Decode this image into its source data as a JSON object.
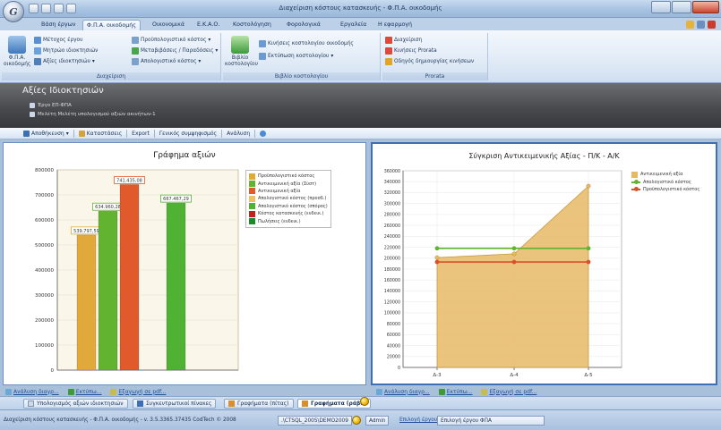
{
  "window": {
    "title": "Διαχείριση κόστους κατασκευής - Φ.Π.Α. οικοδομής",
    "orb_logo": "G"
  },
  "ribbon": {
    "tabs": [
      {
        "label": "Βάση έργων",
        "active": false
      },
      {
        "label": "Φ.Π.Α. οικοδομής",
        "active": true
      },
      {
        "label": "Οικονομικά",
        "active": false
      },
      {
        "label": "Ε.Κ.Α.Ο.",
        "active": false
      },
      {
        "label": "Κοστολόγηση",
        "active": false
      },
      {
        "label": "Φορολογικά",
        "active": false
      },
      {
        "label": "Εργαλεία",
        "active": false
      },
      {
        "label": "Η εφαρμογή",
        "active": false
      }
    ],
    "groups": {
      "management": {
        "label": "Διαχείριση",
        "big_button": "Φ.Π.Α. οικοδομής",
        "items": [
          "Μέτοχος έργου",
          "Μητρώο ιδιοκτησιών",
          "Αξίες ιδιοκτησιών",
          "Προϋπολογιστικό κόστος",
          "Μεταβιβάσεις / Παραδόσεις",
          "Απολογιστικό κόστος"
        ]
      },
      "costing": {
        "label": "Βιβλίο κοστολογίου",
        "big_button": "Βιβλίο κοστολογίου",
        "items": [
          "Κινήσεις κοστολογίου οικοδομής",
          "Εκτύπωση κοστολογίου"
        ]
      },
      "prorata": {
        "label": "Prorata",
        "items": [
          "Διαχείριση",
          "Κινήσεις Prorata",
          "Οδηγός δημιουργίας κινήσεων"
        ]
      }
    }
  },
  "banner": {
    "title": "Αξίες Ιδιοκτησιών",
    "line1": "Έργο ΕΠ-ΦΠΑ",
    "line2": "Μελέτη Μελέτη υπολογισμού αξιών ακινήτων-1"
  },
  "toolbar": {
    "items": [
      "Αποθήκευση",
      "Καταστάσεις",
      "Export",
      "Γενικός συμψηφισμός",
      "Ανάλυση"
    ]
  },
  "links": [
    "Ανάλυση διαγρ...",
    "Εκτύπω...",
    "Εξαγωγή σε pdf..."
  ],
  "bottom_tabs": [
    {
      "label": "Υπολογισμός αξιών ιδιοκτησιών",
      "active": false
    },
    {
      "label": "Συγκεντρωτικοί πίνακες",
      "active": false
    },
    {
      "label": "Γραφήματα (πίτας)",
      "active": false
    },
    {
      "label": "Γραφήματα (ράβδ)",
      "active": true
    }
  ],
  "statusbar": {
    "left": "Διαχείριση κόστους κατασκευής - Φ.Π.Α. οικοδομής - v. 3.5.3365.37435 CodTech © 2008",
    "server": ".\\CTSQL_2005\\DEMO2009",
    "user": "Admin",
    "link": "Επιλογή έργου",
    "project": "Επιλογή έργου ΦΠΑ"
  },
  "colors": {
    "ribbon_active": "#f4f8fd",
    "banner": "#46484b",
    "accent_blue": "#3c6fb4"
  },
  "chart_data": [
    {
      "type": "bar",
      "title": "Γράφημα αξιών",
      "ylim": [
        0,
        800000
      ],
      "yticks": [
        "0",
        "100000",
        "200000",
        "300000",
        "400000",
        "500000",
        "600000",
        "700000",
        "800000"
      ],
      "grid": true,
      "legend_position": "right",
      "series": [
        {
          "name": "Προϋπολογιστικό κόστος",
          "value": 539797.59,
          "label": "539.797,59",
          "color": "#e0a93a"
        },
        {
          "name": "Αντικειμενική αξία (Σύστ)",
          "value": 634960.28,
          "label": "634.960,28",
          "color": "#62b330"
        },
        {
          "name": "Αντικειμενική αξία",
          "value": 741435.08,
          "label": "741.435,08",
          "color": "#e05a2c"
        },
        {
          "name": "Απολογιστικό κόστος (προσδ.)",
          "value": null,
          "label": "",
          "color": "#e8c466"
        },
        {
          "name": "Απολογιστικό κόστος (σπόρος)",
          "value": 667467.29,
          "label": "667.467,29",
          "color": "#4fb233"
        },
        {
          "name": "Κόστος κατασκευής (ενδεικ.)",
          "value": null,
          "label": "",
          "color": "#c42020"
        },
        {
          "name": "Πωλήσεις (ενδεικ.)",
          "value": null,
          "label": "",
          "color": "#1f8a2a"
        }
      ]
    },
    {
      "type": "area",
      "title": "Σύγκριση Αντικειμενικής Αξίας - Π/Κ - Α/Κ",
      "categories": [
        "Δ-3",
        "Δ-4",
        "Δ-5"
      ],
      "ylim": [
        0,
        350000
      ],
      "yticks": [
        "0",
        "20000",
        "40000",
        "60000",
        "80000",
        "100000",
        "120000",
        "140000",
        "160000",
        "180000",
        "200000",
        "220000",
        "240000",
        "260000",
        "280000",
        "300000",
        "320000",
        "340000",
        "360000"
      ],
      "grid": true,
      "legend_position": "top-right",
      "series": [
        {
          "name": "Αντικειμενική αξία",
          "type": "area",
          "values": [
            201000,
            208000,
            332000
          ],
          "color": "#e6b966"
        },
        {
          "name": "Απολογιστικό κόστος",
          "type": "line",
          "values": [
            218000,
            218000,
            218000
          ],
          "color": "#62b330"
        },
        {
          "name": "Προϋπολογιστικό κόστος",
          "type": "line",
          "values": [
            193000,
            193000,
            193000
          ],
          "color": "#d9512b"
        }
      ]
    }
  ]
}
